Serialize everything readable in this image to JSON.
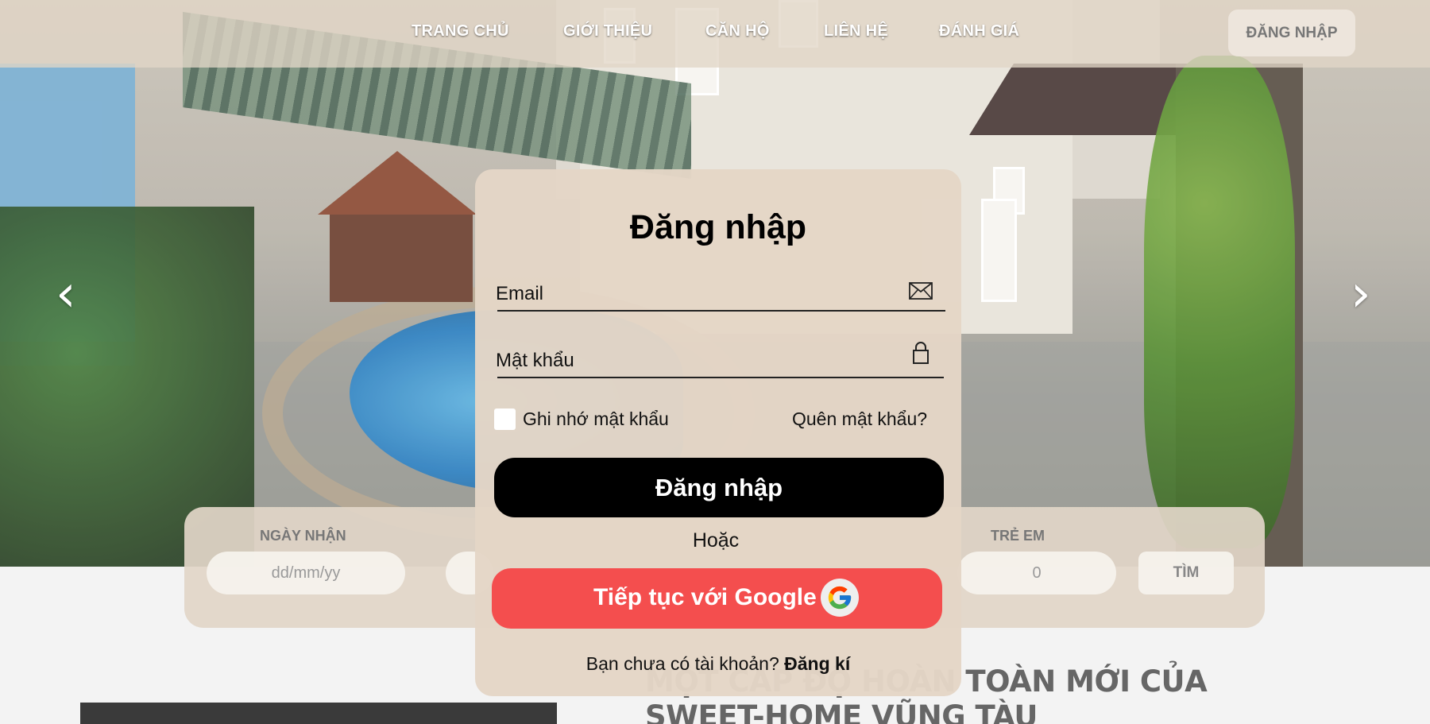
{
  "nav": {
    "links": [
      "TRANG CHỦ",
      "GIỚI THIỆU",
      "CĂN HỘ",
      "LIÊN HỆ",
      "ĐÁNH GIÁ"
    ],
    "login_label": "ĐĂNG NHẬP"
  },
  "hero": {
    "prev_icon": "chevron-left-icon",
    "next_icon": "chevron-right-icon",
    "prev_glyph": "‹",
    "next_glyph": "›"
  },
  "booking": {
    "checkin_label": "NGÀY NHẬN",
    "checkin_placeholder": "dd/mm/yy",
    "children_label": "TRẺ EM",
    "children_value": "0",
    "search_label": "TÌM"
  },
  "section": {
    "title": "MỘT CẤP ĐỘ HOÀN TOÀN MỚI CỦA SWEET-HOME VŨNG TÀU"
  },
  "login_modal": {
    "title": "Đăng nhập",
    "email_label": "Email",
    "password_label": "Mật khẩu",
    "remember_label": "Ghi nhớ mật khẩu",
    "forgot_label": "Quên mật khẩu?",
    "submit_label": "Đăng nhập",
    "or_label": "Hoặc",
    "google_label": "Tiếp tục với Google",
    "no_account_text": "Bạn chưa có tài khoản?",
    "signup_label": "Đăng kí"
  },
  "colors": {
    "google_button": "#f44e4e",
    "submit_button": "#000000",
    "modal_bg": "#e4d6c6"
  }
}
